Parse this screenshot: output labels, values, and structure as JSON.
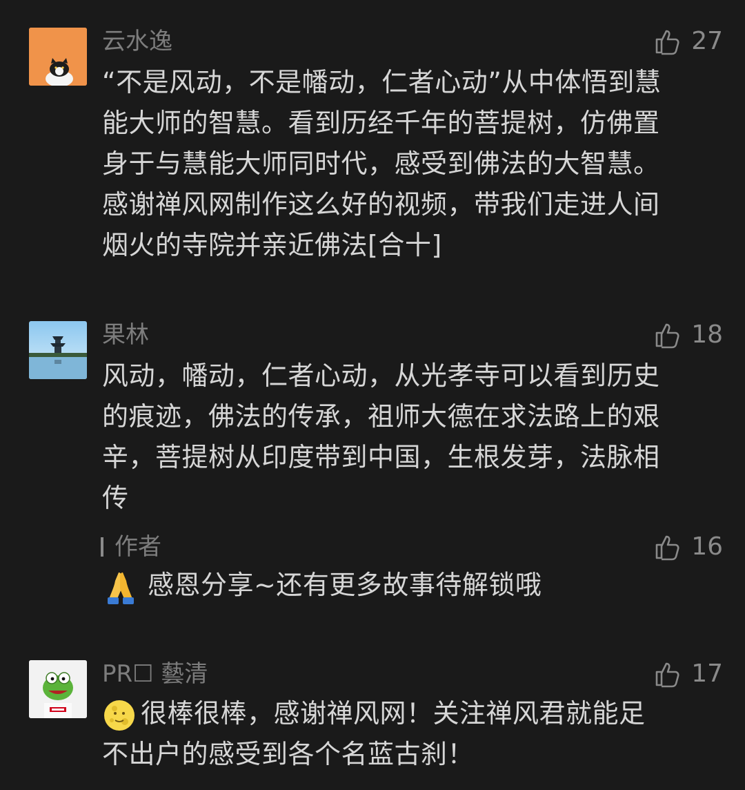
{
  "comments": [
    {
      "username": "云水逸",
      "likes": "27",
      "lines": [
        "“不是风动，不是幡动，仁者心动”从中体悟到慧",
        "能大师的智慧。看到历经千年的菩提树，仿佛置",
        "身于与慧能大师同时代，感受到佛法的大智慧。",
        "感谢禅风网制作这么好的视频，带我们走进人间",
        "烟火的寺院并亲近佛法[合十]"
      ]
    },
    {
      "username": "果林",
      "likes": "18",
      "lines": [
        "风动，幡动，仁者心动，从光孝寺可以看到历史",
        "的痕迹，佛法的传承，祖师大德在求法路上的艰",
        "辛，菩提树从印度带到中国，生根发芽，法脉相",
        "传"
      ],
      "reply": {
        "label": "作者",
        "likes": "16",
        "emoji": "folded-hands-icon",
        "text": "感恩分享~还有更多故事待解锁哦"
      }
    },
    {
      "username": "PR☐ 藝清",
      "likes": "17",
      "emoji": "full-moon-face-icon",
      "lines": [
        "很棒很棒，感谢禅风网！关注禅风君就能足",
        "不出户的感受到各个名蓝古刹！"
      ]
    }
  ],
  "colors": {
    "background": "#1a1a1a",
    "username": "#7d7d7d",
    "text": "#d6d6d6",
    "like": "#8a8a8a"
  }
}
